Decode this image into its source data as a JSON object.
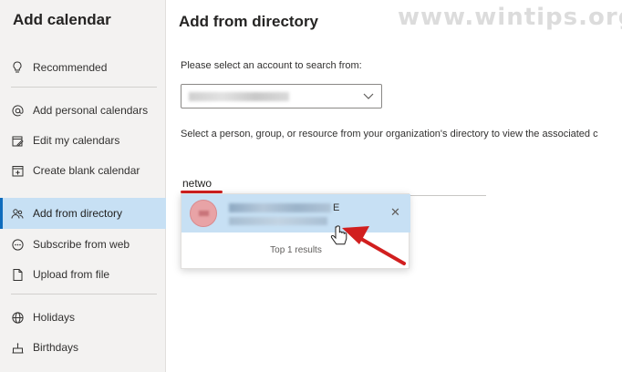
{
  "sidebar": {
    "title": "Add calendar",
    "items": [
      {
        "label": "Recommended",
        "icon": "lightbulb-icon"
      },
      {
        "label": "Add personal calendars",
        "icon": "at-icon"
      },
      {
        "label": "Edit my calendars",
        "icon": "edit-calendar-icon"
      },
      {
        "label": "Create blank calendar",
        "icon": "calendar-add-icon"
      },
      {
        "label": "Add from directory",
        "icon": "people-icon",
        "selected": true
      },
      {
        "label": "Subscribe from web",
        "icon": "more-circle-icon"
      },
      {
        "label": "Upload from file",
        "icon": "file-icon"
      },
      {
        "label": "Holidays",
        "icon": "globe-icon"
      },
      {
        "label": "Birthdays",
        "icon": "cake-icon"
      }
    ]
  },
  "main": {
    "title": "Add from directory",
    "watermark": "www.wintips.org",
    "account_prompt": "Please select an account to search from:",
    "directory_prompt": "Select a person, group, or resource from your organization's directory to view the associated c",
    "search_value": "netwo",
    "result_suffix": "E",
    "results_count": "Top 1 results"
  },
  "colors": {
    "accent": "#0f6cbd",
    "selected_bg": "#c7e0f4",
    "annotation_red": "#d11f1f"
  }
}
